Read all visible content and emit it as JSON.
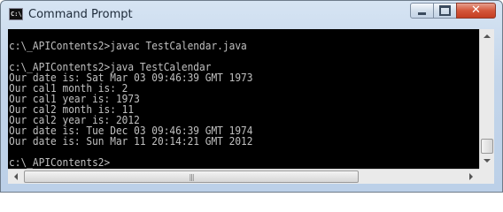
{
  "window": {
    "title": "Command Prompt",
    "icon_text": "C:\\."
  },
  "controls": {
    "minimize": "minimize",
    "maximize": "maximize",
    "close": "✕"
  },
  "console": {
    "lines": [
      "",
      "c:\\_APIContents2>javac TestCalendar.java",
      "",
      "c:\\_APIContents2>java TestCalendar",
      "Our date is: Sat Mar 03 09:46:39 GMT 1973",
      "Our cal1 month is: 2",
      "Our cal1 year is: 1973",
      "Our cal2 month is: 11",
      "Our cal2 year is: 2012",
      "Our date is: Tue Dec 03 09:46:39 GMT 1974",
      "Our date is: Sun Mar 11 20:14:21 GMT 2012",
      "",
      "c:\\_APIContents2>"
    ]
  },
  "scrollbar": {
    "grip": "|||"
  }
}
